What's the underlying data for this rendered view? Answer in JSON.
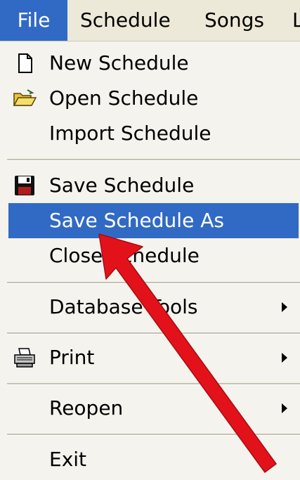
{
  "menubar": {
    "file": "File",
    "schedule": "Schedule",
    "songs": "Songs",
    "cut_off": "L"
  },
  "file_menu": {
    "new_schedule": "New Schedule",
    "open_schedule": "Open Schedule",
    "import_schedule": "Import Schedule",
    "save_schedule": "Save Schedule",
    "save_schedule_as": "Save Schedule As",
    "close_schedule": "Close Schedule",
    "database_tools": "Database Tools",
    "print": "Print",
    "reopen": "Reopen",
    "exit": "Exit"
  },
  "icons": {
    "new_schedule": "new-document-icon",
    "open_schedule": "open-folder-icon",
    "save_schedule": "floppy-disk-icon",
    "print": "printer-icon",
    "submenu": "submenu-arrow-icon"
  },
  "colors": {
    "highlight": "#316ac5",
    "annotation_arrow": "#e3121a",
    "menu_background": "#f4f3ee"
  }
}
